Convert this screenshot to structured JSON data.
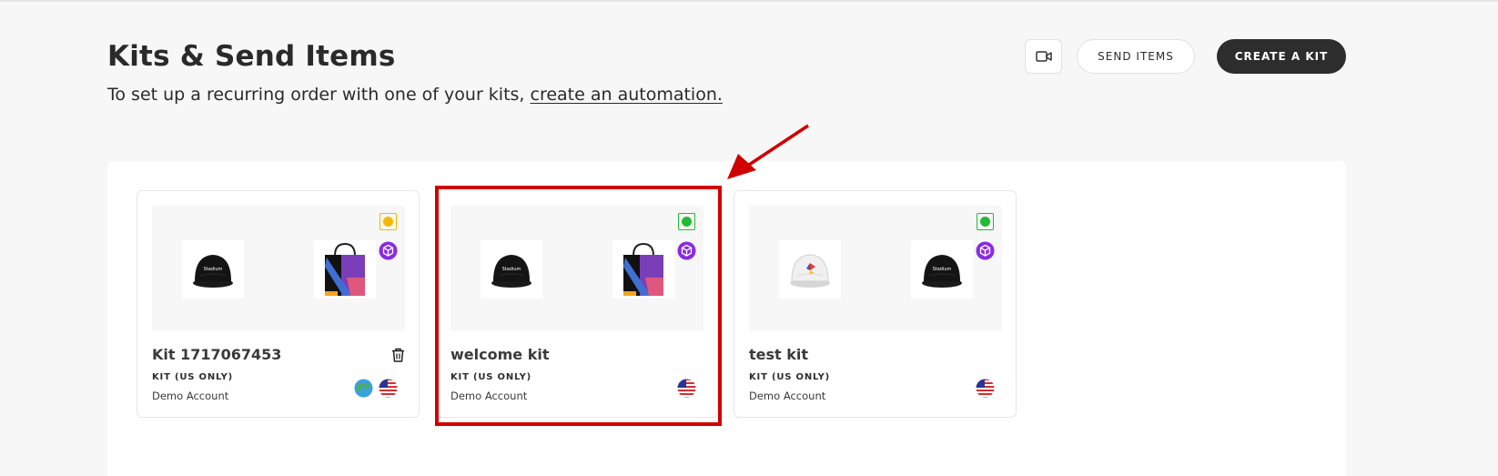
{
  "header": {
    "title": "Kits & Send Items",
    "subtitle_prefix": "To set up a recurring order with one of your kits, ",
    "subtitle_link": "create an automation.",
    "video_icon": "video-camera-icon",
    "send_items_label": "SEND ITEMS",
    "create_kit_label": "CREATE A KIT"
  },
  "kits": [
    {
      "name": "Kit 1717067453",
      "type": "KIT (US ONLY)",
      "account": "Demo Account",
      "status_color": "#f5b800",
      "products": [
        "black-cap",
        "tote-bag"
      ],
      "flags": [
        "globe-icon",
        "us-flag-icon"
      ],
      "has_delete": true
    },
    {
      "name": "welcome kit",
      "type": "KIT (US ONLY)",
      "account": "Demo Account",
      "status_color": "#22bb33",
      "products": [
        "black-cap",
        "tote-bag"
      ],
      "flags": [
        "us-flag-icon"
      ],
      "has_delete": false
    },
    {
      "name": "test kit",
      "type": "KIT (US ONLY)",
      "account": "Demo Account",
      "status_color": "#22bb33",
      "products": [
        "white-cap",
        "black-cap"
      ],
      "flags": [
        "us-flag-icon"
      ],
      "has_delete": false
    }
  ],
  "colors": {
    "accent_purple": "#8a2be2",
    "highlight_red": "#d10000",
    "button_dark": "#2d2d2d"
  }
}
